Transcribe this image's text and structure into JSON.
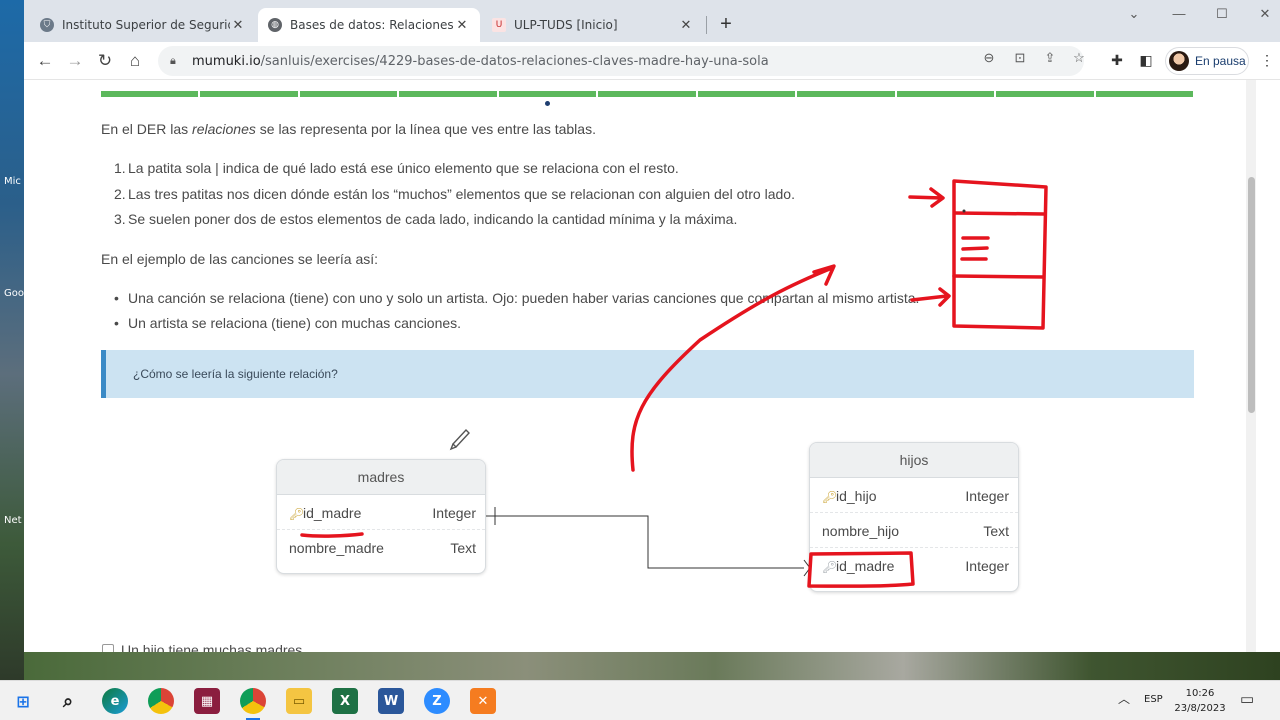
{
  "desktop": {
    "labels": [
      "Mic",
      "Goo",
      "Net"
    ]
  },
  "browser": {
    "tabs": [
      {
        "title": "Instituto Superior de Seguridad P",
        "close": "✕"
      },
      {
        "title": "Bases de datos: Relaciones claves",
        "close": "✕"
      },
      {
        "title": "ULP-TUDS [Inicio]",
        "close": "✕"
      }
    ],
    "new_tab": "+",
    "url_host": "mumuki.io",
    "url_path": "/sanluis/exercises/4229-bases-de-datos-relaciones-claves-madre-hay-una-sola",
    "profile_label": "En pausa"
  },
  "page": {
    "intro_pre": "En el DER las ",
    "intro_em": "relaciones",
    "intro_post": " se las representa por la línea que ves entre las tablas.",
    "numbered": [
      "La patita sola | indica de qué lado está ese único elemento que se relaciona con el resto.",
      "Las tres patitas nos dicen dónde están los “muchos” elementos que se relacionan con alguien del otro lado.",
      "Se suelen poner dos de estos elementos de cada lado, indicando la cantidad mínima y la máxima."
    ],
    "example_intro": "En el ejemplo de las canciones se leería así:",
    "bullets": [
      "Una canción se relaciona (tiene) con uno y solo un artista. Ojo: pueden haber varias canciones que compartan al mismo artista.",
      "Un artista se relaciona (tiene) con muchas canciones."
    ],
    "question": "¿Cómo se leería la siguiente relación?",
    "tables": [
      {
        "name": "madres",
        "rows": [
          {
            "field": "id_madre",
            "type": "Integer",
            "key": "primary"
          },
          {
            "field": "nombre_madre",
            "type": "Text",
            "key": ""
          }
        ]
      },
      {
        "name": "hijos",
        "rows": [
          {
            "field": "id_hijo",
            "type": "Integer",
            "key": "primary"
          },
          {
            "field": "nombre_hijo",
            "type": "Text",
            "key": ""
          },
          {
            "field": "id_madre",
            "type": "Integer",
            "key": "foreign"
          }
        ]
      }
    ],
    "option_partial": "Un hijo tiene muchas madres"
  },
  "taskbar": {
    "lang": "ESP",
    "time": "10:26",
    "date": "23/8/2023"
  },
  "colors": {
    "progress": "#5cb85c",
    "annotation": "#e5141e",
    "question_bg": "#cce3f2",
    "question_border": "#3b8ac6"
  }
}
